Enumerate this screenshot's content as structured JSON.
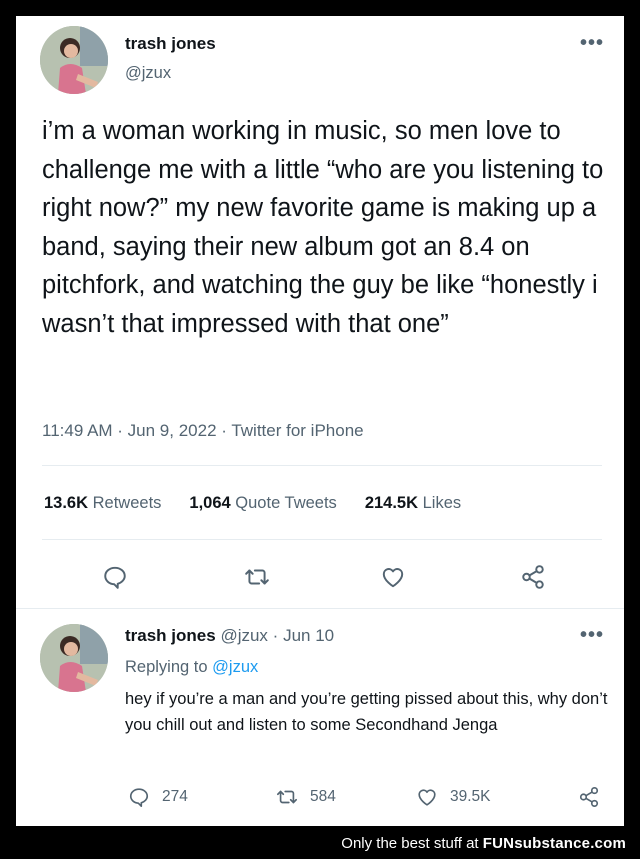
{
  "tweet": {
    "author_name": "trash jones",
    "author_handle": "@jzux",
    "more_icon": "ellipsis-icon",
    "text": "i’m a woman working in music, so men love to challenge me with a little “who are you listening to right now?” my new favorite game is making up a band, saying their new album got an 8.4 on pitchfork, and watching the guy be like “honestly i wasn’t that impressed with that one”",
    "meta": "11:49 AM · Jun 9, 2022 · Twitter for iPhone",
    "stats": [
      {
        "count": "13.6K",
        "label": "Retweets"
      },
      {
        "count": "1,064",
        "label": "Quote Tweets"
      },
      {
        "count": "214.5K",
        "label": "Likes"
      }
    ],
    "actions": [
      "reply-icon",
      "retweet-icon",
      "like-icon",
      "share-icon"
    ]
  },
  "reply": {
    "author_name": "trash jones",
    "author_handle": "@jzux",
    "separator": "·",
    "date": "Jun 10",
    "replying_label": "Replying to",
    "replying_to": "@jzux",
    "text": "hey if you’re a man and you’re getting pissed about this, why don’t you chill out and listen to some Secondhand Jenga",
    "reply_count": "274",
    "retweet_count": "584",
    "like_count": "39.5K"
  },
  "footer": {
    "text": "Only the best stuff at",
    "brand": "FUNsubstance.com"
  },
  "colors": {
    "text": "#0f1419",
    "secondary": "#536471",
    "link": "#1d9bf0",
    "background": "#ffffff",
    "frame": "#000000"
  }
}
